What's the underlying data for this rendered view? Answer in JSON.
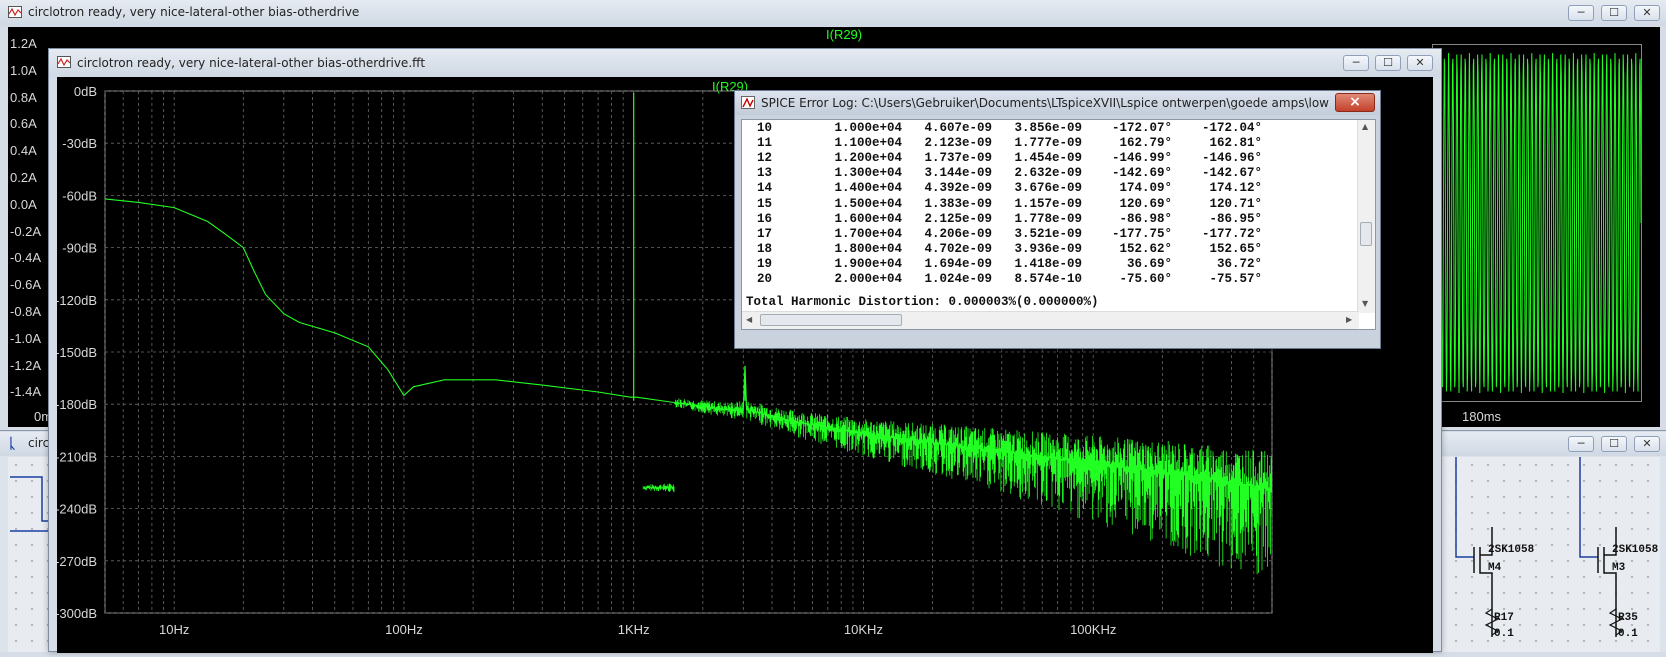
{
  "back_window": {
    "title": "circlotron ready, very nice-lateral-other bias-otherdrive",
    "trace_label": "I(R29)",
    "y_ticks": [
      "1.2A",
      "1.0A",
      "0.8A",
      "0.6A",
      "0.4A",
      "0.2A",
      "0.0A",
      "-0.2A",
      "-0.4A",
      "-0.6A",
      "-0.8A",
      "-1.0A",
      "-1.2A",
      "-1.4A"
    ],
    "x_tick_right": "180ms",
    "x_tick_left": "0m"
  },
  "schematic_window": {
    "title": "circ",
    "parts": [
      {
        "name": "2SK1058",
        "ref": "M4"
      },
      {
        "name": "2SK1058",
        "ref": "M3"
      },
      {
        "name": "R17",
        "value": "0.1"
      },
      {
        "name": "R35",
        "value": "0.1"
      }
    ]
  },
  "fft_window": {
    "title": "circlotron ready, very nice-lateral-other bias-otherdrive.fft",
    "trace_label": "I(R29)",
    "colors": {
      "trace": "#22ff22",
      "background": "#000000",
      "grid": "#6a6a6a"
    }
  },
  "chart_data": {
    "type": "line",
    "title": "I(R29)",
    "x_scale": "log",
    "xlim": [
      5,
      600000
    ],
    "ylim": [
      -300,
      0
    ],
    "x_ticks": [
      "10Hz",
      "100Hz",
      "1KHz",
      "10KHz",
      "100KHz"
    ],
    "y_ticks": [
      "0dB",
      "-30dB",
      "-60dB",
      "-90dB",
      "-120dB",
      "-150dB",
      "-180dB",
      "-210dB",
      "-240dB",
      "-270dB",
      "-300dB"
    ],
    "grid": true,
    "series": [
      {
        "name": "I(R29)",
        "color": "#22ff22",
        "points": [
          [
            5,
            -62
          ],
          [
            7,
            -64
          ],
          [
            10,
            -67
          ],
          [
            14,
            -75
          ],
          [
            17,
            -83
          ],
          [
            20,
            -90
          ],
          [
            22,
            -102
          ],
          [
            25,
            -117
          ],
          [
            30,
            -128
          ],
          [
            35,
            -133
          ],
          [
            50,
            -139
          ],
          [
            70,
            -147
          ],
          [
            85,
            -160
          ],
          [
            100,
            -175
          ],
          [
            110,
            -170
          ],
          [
            150,
            -166
          ],
          [
            250,
            -166
          ],
          [
            400,
            -169
          ],
          [
            700,
            -173
          ],
          [
            970,
            -176
          ],
          [
            1000,
            -1
          ],
          [
            1030,
            -176
          ],
          [
            1500,
            -179
          ],
          [
            2500,
            -183
          ],
          [
            3000,
            -183
          ],
          [
            3050,
            -158
          ],
          [
            3100,
            -183
          ],
          [
            5000,
            -190
          ],
          [
            10000,
            -197
          ],
          [
            30000,
            -205
          ],
          [
            100000,
            -214
          ],
          [
            300000,
            -222
          ],
          [
            550000,
            -228
          ]
        ]
      }
    ]
  },
  "error_log": {
    "title": "SPICE Error Log: C:\\Users\\Gebruiker\\Documents\\LTspiceXVII\\Lspice ontwerpen\\goede amps\\low HD circl...",
    "close_label": "×",
    "rows": [
      {
        "n": "10",
        "freq": "1.000e+04",
        "comp": "4.607e-09",
        "norm": "3.856e-09",
        "phase": "-172.07°",
        "nphase": "-172.04°"
      },
      {
        "n": "11",
        "freq": "1.100e+04",
        "comp": "2.123e-09",
        "norm": "1.777e-09",
        "phase": "162.79°",
        "nphase": "162.81°"
      },
      {
        "n": "12",
        "freq": "1.200e+04",
        "comp": "1.737e-09",
        "norm": "1.454e-09",
        "phase": "-146.99°",
        "nphase": "-146.96°"
      },
      {
        "n": "13",
        "freq": "1.300e+04",
        "comp": "3.144e-09",
        "norm": "2.632e-09",
        "phase": "-142.69°",
        "nphase": "-142.67°"
      },
      {
        "n": "14",
        "freq": "1.400e+04",
        "comp": "4.392e-09",
        "norm": "3.676e-09",
        "phase": "174.09°",
        "nphase": "174.12°"
      },
      {
        "n": "15",
        "freq": "1.500e+04",
        "comp": "1.383e-09",
        "norm": "1.157e-09",
        "phase": "120.69°",
        "nphase": "120.71°"
      },
      {
        "n": "16",
        "freq": "1.600e+04",
        "comp": "2.125e-09",
        "norm": "1.778e-09",
        "phase": "-86.98°",
        "nphase": "-86.95°"
      },
      {
        "n": "17",
        "freq": "1.700e+04",
        "comp": "4.206e-09",
        "norm": "3.521e-09",
        "phase": "-177.75°",
        "nphase": "-177.72°"
      },
      {
        "n": "18",
        "freq": "1.800e+04",
        "comp": "4.702e-09",
        "norm": "3.936e-09",
        "phase": "152.62°",
        "nphase": "152.65°"
      },
      {
        "n": "19",
        "freq": "1.900e+04",
        "comp": "1.694e-09",
        "norm": "1.418e-09",
        "phase": "36.69°",
        "nphase": "36.72°"
      },
      {
        "n": "20",
        "freq": "2.000e+04",
        "comp": "1.024e-09",
        "norm": "8.574e-10",
        "phase": "-75.60°",
        "nphase": "-75.57°"
      }
    ],
    "thd_line": "Total Harmonic Distortion: 0.000003%(0.000000%)"
  },
  "buttons": {
    "minimize": "─",
    "maximize": "☐",
    "close": "✕"
  }
}
